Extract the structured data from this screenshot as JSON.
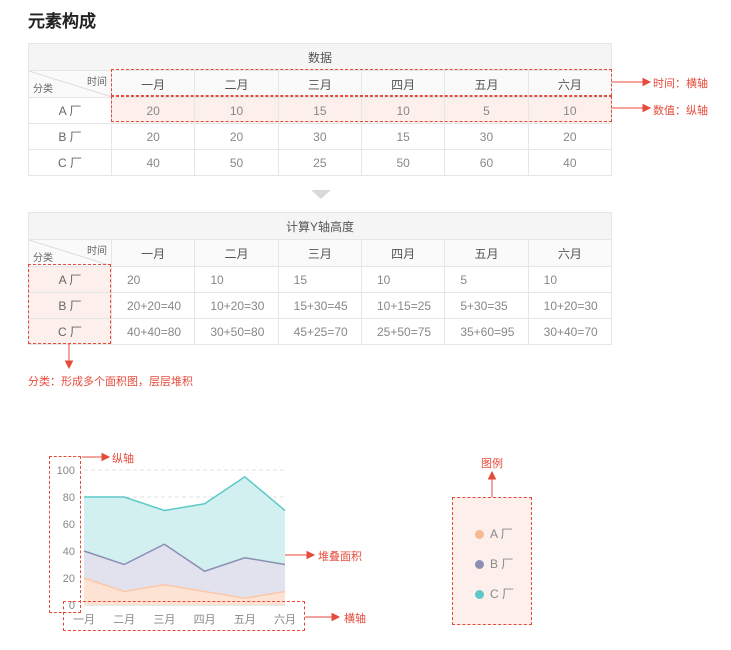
{
  "page_title": "元素构成",
  "table1": {
    "caption": "数据",
    "corner_top": "时间",
    "corner_bottom": "分类",
    "months": [
      "一月",
      "二月",
      "三月",
      "四月",
      "五月",
      "六月"
    ],
    "rows": [
      {
        "name": "A 厂",
        "values": [
          "20",
          "10",
          "15",
          "10",
          "5",
          "10"
        ]
      },
      {
        "name": "B 厂",
        "values": [
          "20",
          "20",
          "30",
          "15",
          "30",
          "20"
        ]
      },
      {
        "name": "C 厂",
        "values": [
          "40",
          "50",
          "25",
          "50",
          "60",
          "40"
        ]
      }
    ]
  },
  "table2": {
    "caption": "计算Y轴高度",
    "corner_top": "时间",
    "corner_bottom": "分类",
    "months": [
      "一月",
      "二月",
      "三月",
      "四月",
      "五月",
      "六月"
    ],
    "rows": [
      {
        "name": "A 厂",
        "values": [
          "20",
          "10",
          "15",
          "10",
          "5",
          "10"
        ]
      },
      {
        "name": "B 厂",
        "values": [
          "20+20=40",
          "10+20=30",
          "15+30=45",
          "10+15=25",
          "5+30=35",
          "10+20=30"
        ]
      },
      {
        "name": "C 厂",
        "values": [
          "40+40=80",
          "30+50=80",
          "45+25=70",
          "25+50=75",
          "35+60=95",
          "30+40=70"
        ]
      }
    ]
  },
  "annotations": {
    "time_axis": "时间：横轴",
    "value_axis": "数值：纵轴",
    "category": "分类：形成多个面积图，层层堆积",
    "y_axis": "纵轴",
    "stacked_area": "堆叠面积",
    "x_axis": "横轴",
    "legend": "图例"
  },
  "colors": {
    "accent": "#e64a3b",
    "series_a": "#fbc8a8",
    "series_b": "#8b8fb3",
    "series_c": "#5cc9c6"
  },
  "legend": [
    {
      "label": "A 厂",
      "color": "#f7b994"
    },
    {
      "label": "B 厂",
      "color": "#8b8fb3"
    },
    {
      "label": "C 厂",
      "color": "#5cc9c6"
    }
  ],
  "chart_data": {
    "type": "area",
    "stacked": true,
    "title": "",
    "xlabel": "",
    "ylabel": "",
    "categories": [
      "一月",
      "二月",
      "三月",
      "四月",
      "五月",
      "六月"
    ],
    "series": [
      {
        "name": "A 厂",
        "values": [
          20,
          10,
          15,
          10,
          5,
          10
        ]
      },
      {
        "name": "B 厂",
        "values": [
          20,
          20,
          30,
          15,
          30,
          20
        ]
      },
      {
        "name": "C 厂",
        "values": [
          40,
          50,
          25,
          50,
          60,
          40
        ]
      }
    ],
    "ylim": [
      0,
      100
    ],
    "yticks": [
      0,
      20,
      40,
      60,
      80,
      100
    ],
    "grid": true
  }
}
